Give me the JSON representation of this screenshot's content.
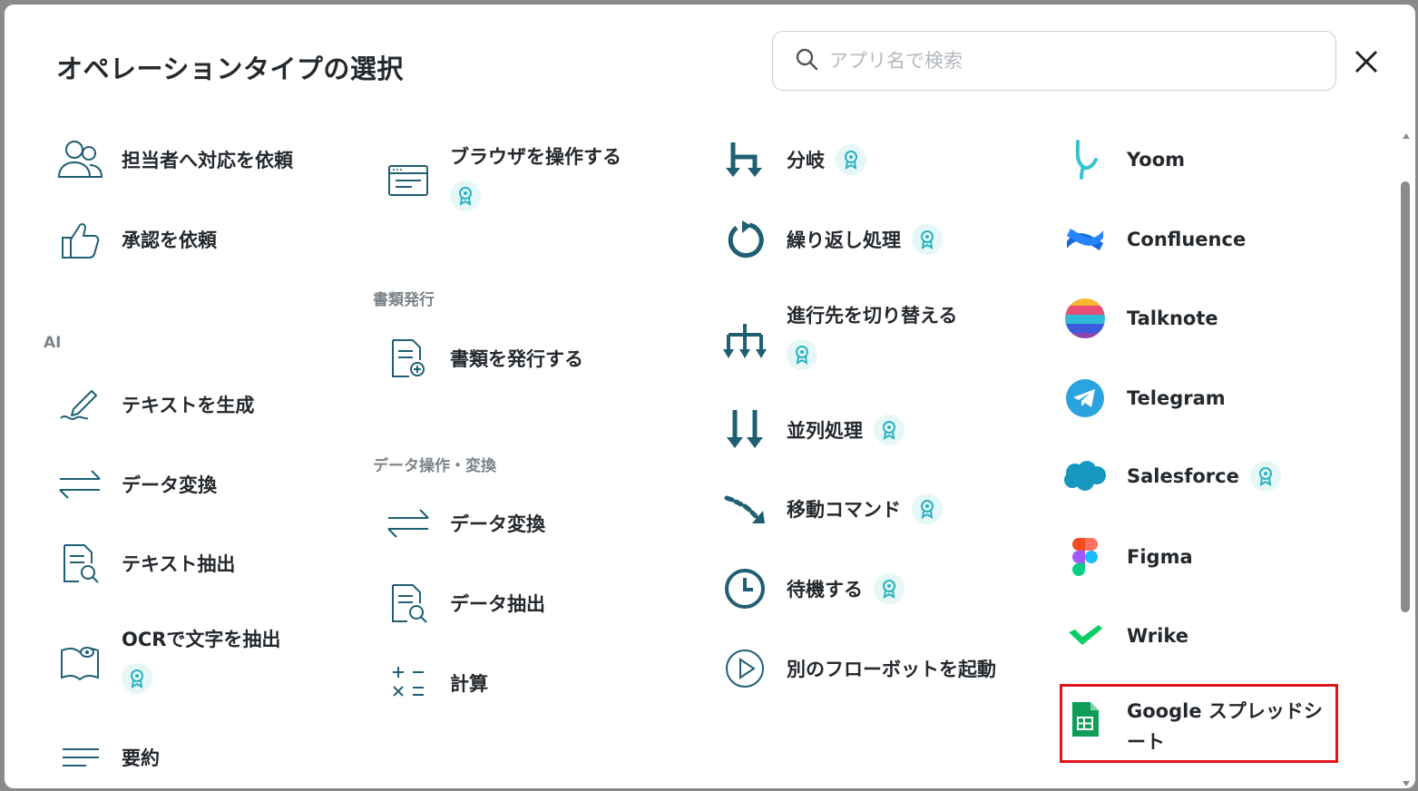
{
  "title": "オペレーションタイプの選択",
  "search": {
    "placeholder": "アプリ名で検索",
    "value": ""
  },
  "sections": {
    "ai": "AI",
    "documents": "書類発行",
    "data_ops": "データ操作・変換"
  },
  "col1": {
    "assign": "担当者へ対応を依頼",
    "approval": "承認を依頼",
    "text_gen": "テキストを生成",
    "data_convert": "データ変換",
    "text_extract": "テキスト抽出",
    "ocr": "OCRで文字を抽出",
    "summary": "要約"
  },
  "col2": {
    "browser": "ブラウザを操作する",
    "issue_doc": "書類を発行する",
    "data_convert": "データ変換",
    "data_extract": "データ抽出",
    "calc": "計算"
  },
  "col3": {
    "branch": "分岐",
    "loop": "繰り返し処理",
    "switch": "進行先を切り替える",
    "parallel": "並列処理",
    "move": "移動コマンド",
    "wait": "待機する",
    "launch": "別のフローボットを起動"
  },
  "col4": {
    "yoom": "Yoom",
    "confluence": "Confluence",
    "talknote": "Talknote",
    "telegram": "Telegram",
    "salesforce": "Salesforce",
    "figma": "Figma",
    "wrike": "Wrike",
    "gsheets": "Google スプレッドシート"
  },
  "colors": {
    "icon_teal": "#1f5f73",
    "badge_bg": "#e6f7f8",
    "badge_fg": "#27b3c0",
    "highlight": "#e0151b"
  }
}
